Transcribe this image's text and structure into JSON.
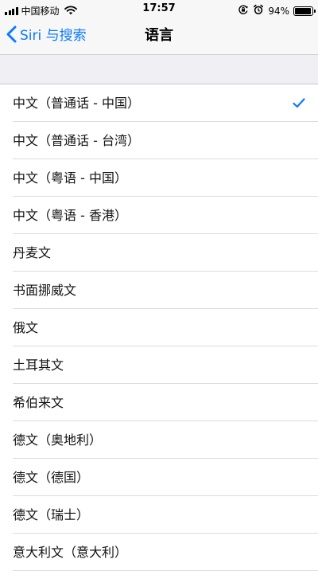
{
  "status_bar": {
    "carrier": "中国移动",
    "time": "17:57",
    "battery_percent": "94%",
    "battery_level": 0.94,
    "icons": [
      "signal-icon",
      "wifi-icon",
      "orientation-lock-icon",
      "alarm-icon",
      "battery-icon"
    ]
  },
  "nav": {
    "back_label": "Siri 与搜索",
    "title": "语言"
  },
  "colors": {
    "accent": "#0a7aff",
    "group_background": "#efeff4"
  },
  "languages": [
    {
      "label": "中文（普通话 - 中国）",
      "selected": true
    },
    {
      "label": "中文（普通话 - 台湾）",
      "selected": false
    },
    {
      "label": "中文（粤语 - 中国）",
      "selected": false
    },
    {
      "label": "中文（粤语 - 香港）",
      "selected": false
    },
    {
      "label": "丹麦文",
      "selected": false
    },
    {
      "label": "书面挪威文",
      "selected": false
    },
    {
      "label": "俄文",
      "selected": false
    },
    {
      "label": "土耳其文",
      "selected": false
    },
    {
      "label": "希伯来文",
      "selected": false
    },
    {
      "label": "德文（奥地利）",
      "selected": false
    },
    {
      "label": "德文（德国）",
      "selected": false
    },
    {
      "label": "德文（瑞士）",
      "selected": false
    },
    {
      "label": "意大利文（意大利）",
      "selected": false
    }
  ]
}
